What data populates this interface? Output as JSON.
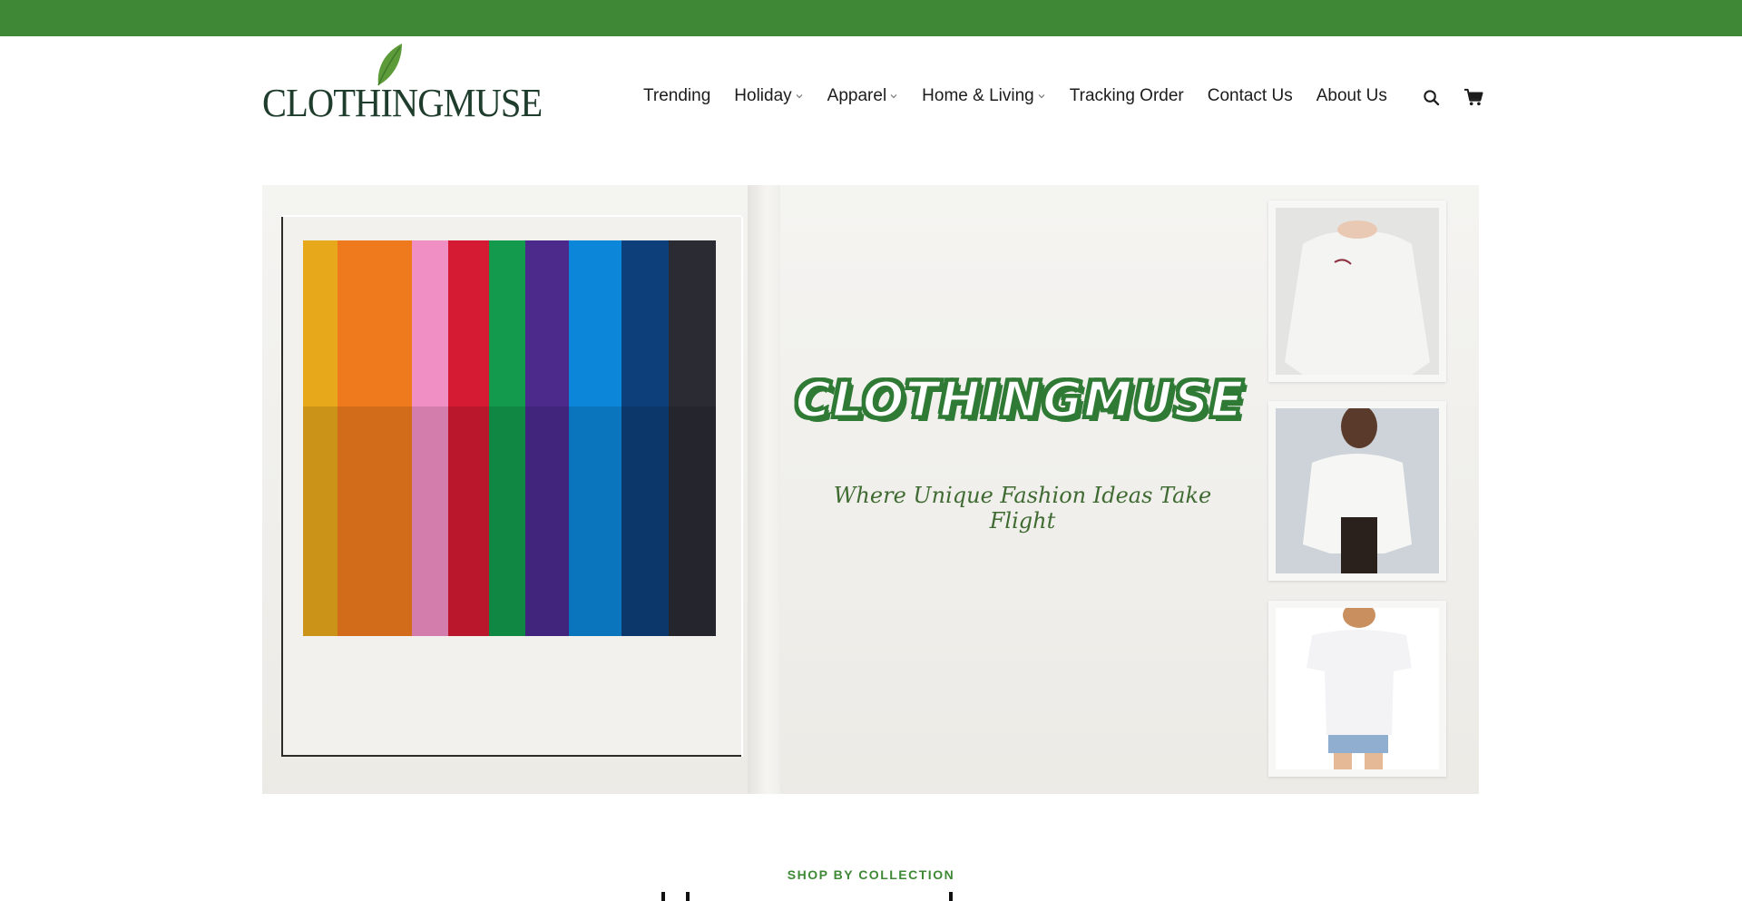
{
  "logo": {
    "text": "CLOTHINGMUSE",
    "alt": "ClothingMuse"
  },
  "nav": {
    "items": [
      {
        "label": "Trending"
      },
      {
        "label": "Holiday"
      },
      {
        "label": "Apparel"
      },
      {
        "label": "Home & Living"
      },
      {
        "label": "Tracking Order"
      },
      {
        "label": "Contact Us"
      },
      {
        "label": "About Us"
      }
    ]
  },
  "header_icons": [
    "search-icon",
    "cart-icon"
  ],
  "hero": {
    "title": "CLOTHINGMUSE",
    "tagline": "Where Unique Fashion Ideas Take Flight"
  },
  "section": {
    "label": "SHOP BY COLLECTION"
  },
  "colors": {
    "top_bar": "#3e8836",
    "accent": "#3e8836",
    "hero_bg": "#efeeea"
  }
}
